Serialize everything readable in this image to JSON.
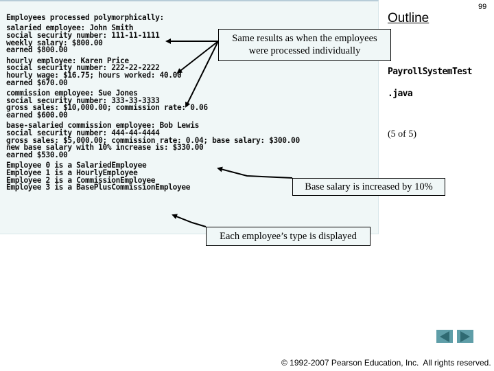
{
  "header": {
    "outline_label": "Outline",
    "page_number": "99",
    "file_name_line1": "PayrollSystemTest",
    "file_name_line2": ".java",
    "page_of": "(5 of  5)"
  },
  "console": {
    "blocks": [
      [
        "Employees processed polymorphically:"
      ],
      [
        "salaried employee: John Smith",
        "social security number: 111-11-1111",
        "weekly salary: $800.00",
        "earned $800.00"
      ],
      [
        "hourly employee: Karen Price",
        "social security number: 222-22-2222",
        "hourly wage: $16.75; hours worked: 40.00",
        "earned $670.00"
      ],
      [
        "commission employee: Sue Jones",
        "social security number: 333-33-3333",
        "gross sales: $10,000.00; commission rate: 0.06",
        "earned $600.00"
      ],
      [
        "base-salaried commission employee: Bob Lewis",
        "social security number: 444-44-4444",
        "gross sales: $5,000.00; commission rate: 0.04; base salary: $300.00",
        "new base salary with 10% increase is: $330.00",
        "earned $530.00"
      ],
      [
        "Employee 0 is a SalariedEmployee",
        "Employee 1 is a HourlyEmployee",
        "Employee 2 is a CommissionEmployee",
        "Employee 3 is a BasePlusCommissionEmployee"
      ]
    ]
  },
  "callouts": {
    "same_results_line1": "Same results as when the employees",
    "same_results_line2": "were processed individually",
    "base_salary": "Base salary is increased by 10%",
    "type_displayed": "Each employee’s type is displayed"
  },
  "navigation": {
    "prev_icon": "triangle-left",
    "next_icon": "triangle-right",
    "button_color": "#5f9ea8"
  },
  "footer": {
    "copyright": "© 1992-2007 Pearson Education, Inc.  All rights reserved."
  }
}
